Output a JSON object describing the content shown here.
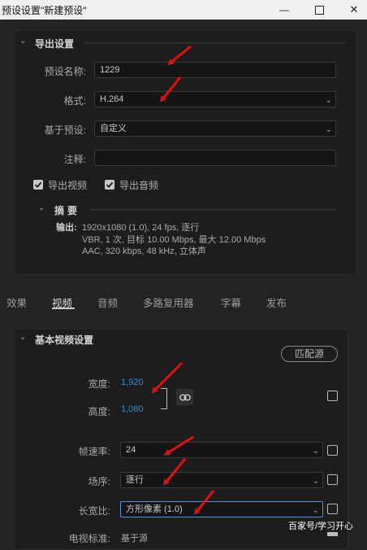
{
  "window": {
    "title": "预设设置\"新建预设\"",
    "min_glyph": "—",
    "close_glyph": "✕"
  },
  "export": {
    "section_title": "导出设置",
    "preset_name_label": "预设名称:",
    "preset_name_value": "1229",
    "format_label": "格式:",
    "format_value": "H.264",
    "base_preset_label": "基于预设:",
    "base_preset_value": "自定义",
    "comment_label": "注释:",
    "comment_value": "",
    "export_video_label": "导出视频",
    "export_video_checked": true,
    "export_audio_label": "导出音频",
    "export_audio_checked": true,
    "summary_title": "摘要",
    "summary_output_label": "输出:",
    "summary_lines": [
      "1920x1080 (1.0), 24 fps, 逐行",
      "VBR, 1 次, 目标 10.00 Mbps, 最大 12.00 Mbps",
      "AAC, 320 kbps, 48 kHz, 立体声"
    ]
  },
  "tabs": [
    {
      "label": "效果",
      "active": false
    },
    {
      "label": "视频",
      "active": true
    },
    {
      "label": "音频",
      "active": false
    },
    {
      "label": "多路复用器",
      "active": false
    },
    {
      "label": "字幕",
      "active": false
    },
    {
      "label": "发布",
      "active": false
    }
  ],
  "video": {
    "section_title": "基本视频设置",
    "match_source_label": "匹配源",
    "width_label": "宽度:",
    "width_value": "1,920",
    "height_label": "高度:",
    "height_value": "1,080",
    "frame_rate_label": "帧速率:",
    "frame_rate_value": "24",
    "field_order_label": "场序:",
    "field_order_value": "逐行",
    "aspect_label": "长宽比:",
    "aspect_value": "方形像素 (1.0)",
    "tv_standard_label": "电视标准:",
    "tv_standard_value": "基于源"
  },
  "watermark": "百家号/学习开心",
  "colors": {
    "accent_blue": "#2d8ceb",
    "annotation_red": "#e01010",
    "panel_bg": "#1d1d1d",
    "window_bg": "#232323"
  }
}
